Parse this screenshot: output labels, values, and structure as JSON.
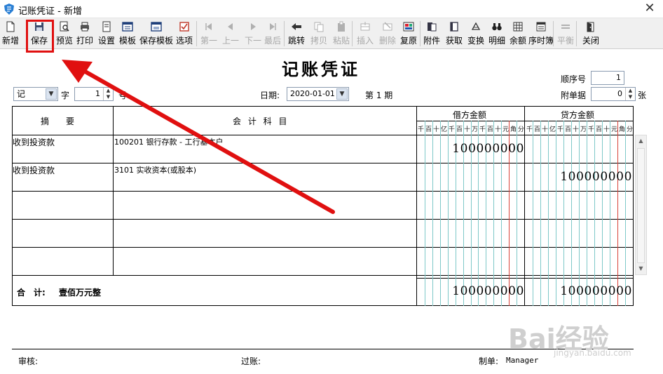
{
  "window": {
    "title": "记账凭证 - 新增",
    "close_glyph": "✕"
  },
  "toolbar": [
    {
      "id": "new",
      "label": "新增",
      "icon": "new-doc-icon",
      "disabled": false
    },
    {
      "id": "save",
      "label": "保存",
      "icon": "floppy-disk-icon",
      "disabled": false
    },
    {
      "id": "preview",
      "label": "预览",
      "icon": "preview-icon",
      "disabled": false
    },
    {
      "id": "print",
      "label": "打印",
      "icon": "printer-icon",
      "disabled": false
    },
    {
      "id": "settings",
      "label": "设置",
      "icon": "page-setup-icon",
      "disabled": false
    },
    {
      "id": "template",
      "label": "模板",
      "icon": "template-icon",
      "disabled": false
    },
    {
      "id": "save-template",
      "label": "保存模板",
      "icon": "save-template-icon",
      "disabled": false
    },
    {
      "id": "options",
      "label": "选项",
      "icon": "options-icon",
      "disabled": false
    },
    {
      "id": "first",
      "label": "第一",
      "icon": "first-icon",
      "disabled": true
    },
    {
      "id": "prev",
      "label": "上一",
      "icon": "prev-icon",
      "disabled": true
    },
    {
      "id": "next",
      "label": "下一",
      "icon": "next-icon",
      "disabled": true
    },
    {
      "id": "last",
      "label": "最后",
      "icon": "last-icon",
      "disabled": true
    },
    {
      "id": "jump",
      "label": "跳转",
      "icon": "jump-arrow-icon",
      "disabled": false
    },
    {
      "id": "copy",
      "label": "拷贝",
      "icon": "copy-icon",
      "disabled": true
    },
    {
      "id": "paste",
      "label": "粘贴",
      "icon": "paste-icon",
      "disabled": true
    },
    {
      "id": "insert",
      "label": "插入",
      "icon": "insert-row-icon",
      "disabled": true
    },
    {
      "id": "delete",
      "label": "删除",
      "icon": "delete-row-icon",
      "disabled": true
    },
    {
      "id": "restore",
      "label": "复原",
      "icon": "restore-icon",
      "disabled": false
    },
    {
      "id": "attach",
      "label": "附件",
      "icon": "attachment-icon",
      "disabled": false
    },
    {
      "id": "fetch",
      "label": "获取",
      "icon": "fetch-icon",
      "disabled": false
    },
    {
      "id": "exchange",
      "label": "变换",
      "icon": "transform-icon",
      "disabled": false
    },
    {
      "id": "detail",
      "label": "明细",
      "icon": "binoculars-icon",
      "disabled": false
    },
    {
      "id": "balance",
      "label": "余额",
      "icon": "balance-grid-icon",
      "disabled": false
    },
    {
      "id": "journal",
      "label": "序时簿",
      "icon": "journal-icon",
      "disabled": false
    },
    {
      "id": "equalize",
      "label": "平衡",
      "icon": "equals-icon",
      "disabled": true
    },
    {
      "id": "close",
      "label": "关闭",
      "icon": "exit-door-icon",
      "disabled": false
    }
  ],
  "voucher": {
    "title": "记账凭证",
    "seq_label": "顺序号",
    "seq_value": "1",
    "word_value": "记",
    "word_label": "字",
    "number_value": "1",
    "number_label": "号",
    "date_label": "日期:",
    "date_value": "2020-01-01",
    "period_text": "第 1 期",
    "attach_label": "附单据",
    "attach_value": "0",
    "attach_unit": "张"
  },
  "table": {
    "col_summary": "摘　　要",
    "col_account": "会 计 科 目",
    "col_debit": "借方金额",
    "col_credit": "贷方金额",
    "digit_units": [
      "千",
      "百",
      "十",
      "亿",
      "千",
      "百",
      "十",
      "万",
      "千",
      "百",
      "十",
      "元",
      "角",
      "分"
    ],
    "rows": [
      {
        "summary": "收到投资款",
        "account": "100201 银行存款 - 工行基本户",
        "debit": "100000000",
        "credit": ""
      },
      {
        "summary": "收到投资款",
        "account": "3101 实收资本(或股本)",
        "debit": "",
        "credit": "100000000"
      },
      {
        "summary": "",
        "account": "",
        "debit": "",
        "credit": ""
      },
      {
        "summary": "",
        "account": "",
        "debit": "",
        "credit": ""
      },
      {
        "summary": "",
        "account": "",
        "debit": "",
        "credit": ""
      }
    ],
    "total_label": "合　计:",
    "total_words": "壹佰万元整",
    "total_debit": "100000000",
    "total_credit": "100000000"
  },
  "footer": {
    "audit_label": "审核:",
    "post_label": "过账:",
    "maker_label": "制单:",
    "maker_value": "Manager"
  },
  "watermark": {
    "text": "Bai经验",
    "sub": "jingyan.baidu.com"
  },
  "colors": {
    "annotation_red": "#e01010",
    "digit_line": "#7ec8c8",
    "unit_line_red": "#d9433a"
  }
}
